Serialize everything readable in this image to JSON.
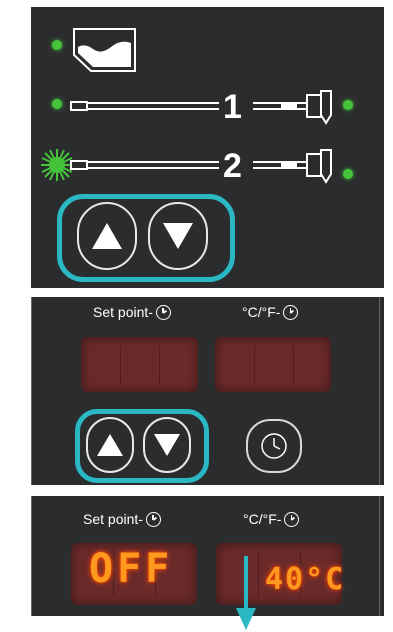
{
  "panel1": {
    "cable1_number": "1",
    "cable2_number": "2",
    "up_icon": "triangle-up-icon",
    "down_icon": "triangle-down-icon"
  },
  "panel2": {
    "setpoint_label": "Set point-",
    "unit_label": "°C/°F-",
    "timer_icon": "clock-icon"
  },
  "panel3": {
    "setpoint_label": "Set point-",
    "unit_label": "°C/°F-",
    "left_display_value": "OFF",
    "right_display_value": "40°C"
  },
  "colors": {
    "panel": "#2b2c2e",
    "led_green": "#45c43a",
    "highlight": "#2bb8c5",
    "display_red": "#6b2a2a",
    "segment_orange": "#ff9a1e"
  }
}
